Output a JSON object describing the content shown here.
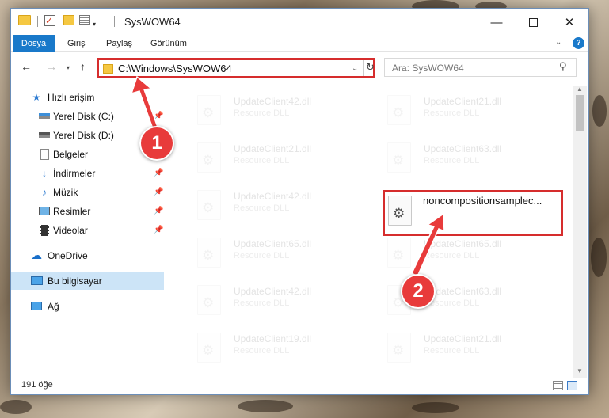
{
  "window": {
    "title": "SysWOW64"
  },
  "ribbon": {
    "tabs": [
      "Dosya",
      "Giriş",
      "Paylaş",
      "Görünüm"
    ]
  },
  "address": {
    "path": "C:\\Windows\\SysWOW64"
  },
  "search": {
    "placeholder": "Ara: SysWOW64"
  },
  "sidebar": {
    "items": [
      {
        "label": "Hızlı erişim",
        "icon": "star-icon",
        "pinned": false
      },
      {
        "label": "Yerel Disk (C:)",
        "icon": "drive-icon",
        "pinned": true
      },
      {
        "label": "Yerel Disk (D:)",
        "icon": "drive-icon",
        "pinned": false
      },
      {
        "label": "Belgeler",
        "icon": "document-icon",
        "pinned": true
      },
      {
        "label": "İndirmeler",
        "icon": "download-icon",
        "pinned": true
      },
      {
        "label": "Müzik",
        "icon": "music-icon",
        "pinned": true
      },
      {
        "label": "Resimler",
        "icon": "pictures-icon",
        "pinned": true
      },
      {
        "label": "Videolar",
        "icon": "video-icon",
        "pinned": true
      },
      {
        "label": "OneDrive",
        "icon": "cloud-icon",
        "pinned": false
      },
      {
        "label": "Bu bilgisayar",
        "icon": "computer-icon",
        "pinned": false,
        "selected": true
      },
      {
        "label": "Ağ",
        "icon": "network-icon",
        "pinned": false
      }
    ]
  },
  "files": [
    {
      "name": "UpdateClient42.dll",
      "type": "Resource DLL"
    },
    {
      "name": "UpdateClient21.dll",
      "type": "Resource DLL"
    },
    {
      "name": "UpdateClient21.dll",
      "type": "Resource DLL"
    },
    {
      "name": "UpdateClient63.dll",
      "type": "Resource DLL"
    },
    {
      "name": "UpdateClient42.dll",
      "type": "Resource DLL"
    },
    {
      "name": "noncompositionsamplec...",
      "type": ""
    },
    {
      "name": "UpdateClient65.dll",
      "type": "Resource DLL"
    },
    {
      "name": "UpdateClient65.dll",
      "type": "Resource DLL"
    },
    {
      "name": "UpdateClient42.dll",
      "type": "Resource DLL"
    },
    {
      "name": "UpdateClient63.dll",
      "type": "Resource DLL"
    },
    {
      "name": "UpdateClient19.dll",
      "type": "Resource DLL"
    },
    {
      "name": "UpdateClient21.dll",
      "type": "Resource DLL"
    }
  ],
  "status": {
    "count": "191 öğe"
  },
  "callouts": [
    "1",
    "2"
  ],
  "colors": {
    "accent": "#1979ca",
    "highlight_red": "#d62d2d",
    "callout_red": "#e83b3b",
    "selection": "#cce4f7"
  }
}
